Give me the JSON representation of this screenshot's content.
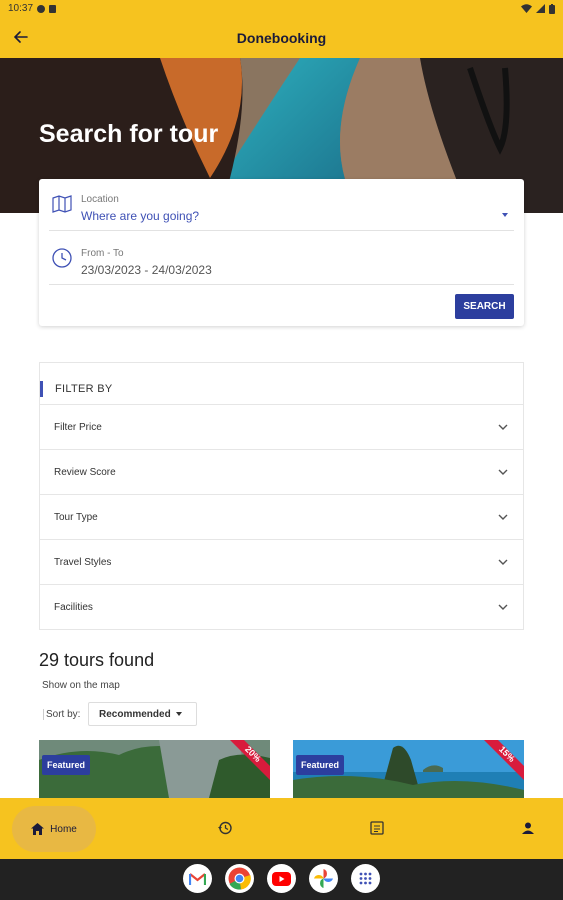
{
  "status": {
    "time": "10:37"
  },
  "app": {
    "title": "Donebooking"
  },
  "hero": {
    "title": "Search for tour"
  },
  "search": {
    "location_label": "Location",
    "location_placeholder": "Where are you going?",
    "dates_label": "From - To",
    "dates_value": "23/03/2023 - 24/03/2023",
    "button": "SEARCH"
  },
  "filters": {
    "heading": "FILTER BY",
    "items": [
      {
        "label": "Filter Price"
      },
      {
        "label": "Review Score"
      },
      {
        "label": "Tour Type"
      },
      {
        "label": "Travel Styles"
      },
      {
        "label": "Facilities"
      }
    ]
  },
  "results": {
    "count_text": "29 tours found",
    "map_link": "Show on the map",
    "sort_label": "Sort by:",
    "sort_value": "Recommended"
  },
  "tours": [
    {
      "badge": "Featured",
      "discount": "20%"
    },
    {
      "badge": "Featured",
      "discount": "15%"
    }
  ],
  "bottom_nav": {
    "home_label": "Home"
  },
  "colors": {
    "brand_yellow": "#f6c31f",
    "accent_blue": "#2c3e9e",
    "discount_red": "#d81b3c"
  },
  "dock_icons": [
    "gmail-icon",
    "chrome-icon",
    "youtube-icon",
    "photos-icon",
    "apps-icon"
  ]
}
